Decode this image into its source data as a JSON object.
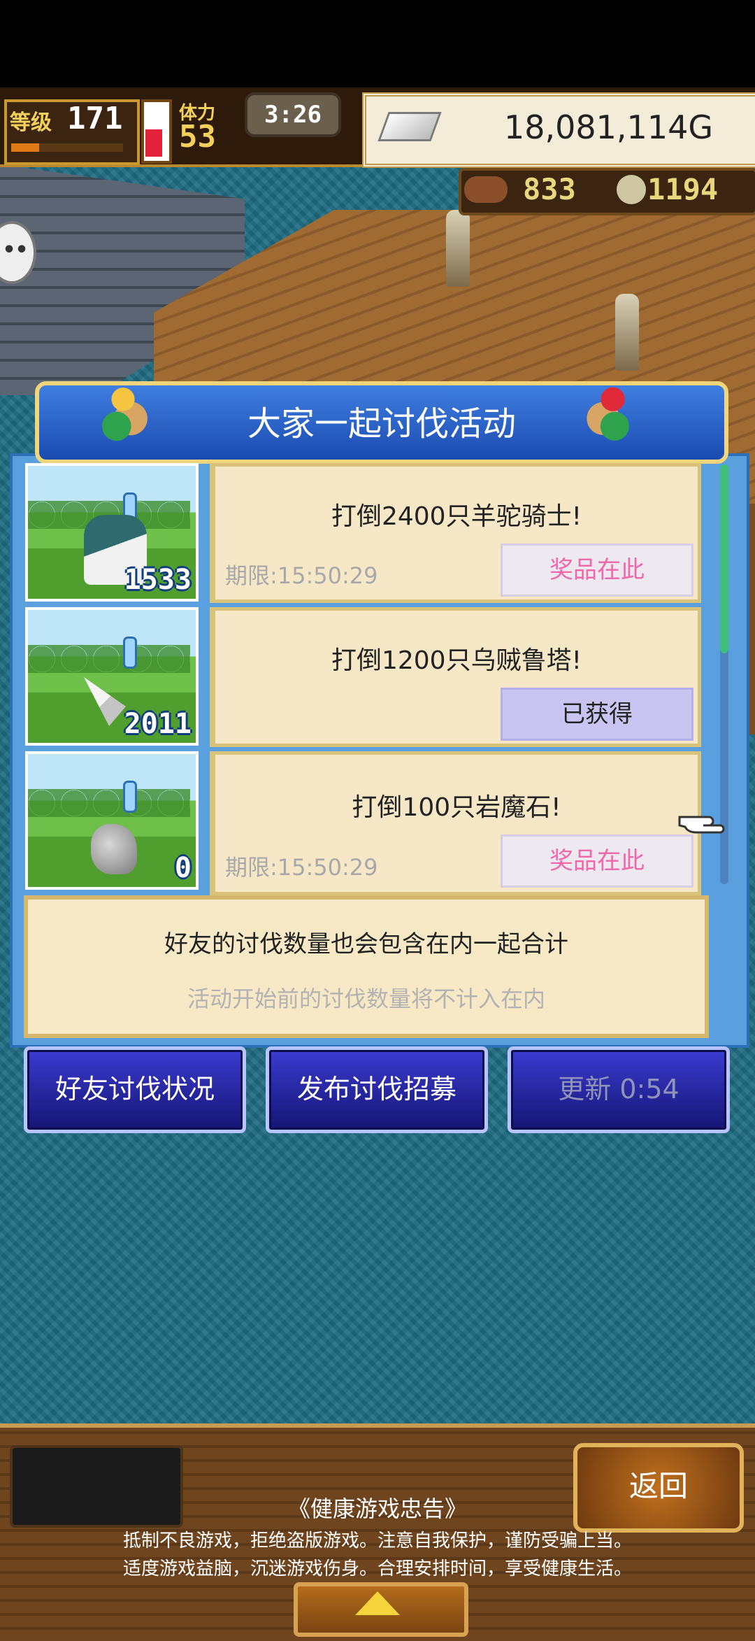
{
  "hud": {
    "level_label": "等级",
    "level": "171",
    "points_label": "体力",
    "points": "53",
    "clock": "3:26",
    "money": "18,081,114G",
    "food": "833",
    "medals": "1194"
  },
  "event": {
    "title": "大家一起讨伐活动",
    "missions": [
      {
        "text": "打倒2400只羊驼骑士!",
        "count": "1533",
        "deadline": "期限:15:50:29",
        "reward": "奖品在此",
        "claimed": false
      },
      {
        "text": "打倒1200只乌贼鲁塔!",
        "count": "2011",
        "deadline": "",
        "reward": "已获得",
        "claimed": true
      },
      {
        "text": "打倒100只岩魔石!",
        "count": "0",
        "deadline": "期限:15:50:29",
        "reward": "奖品在此",
        "claimed": false
      }
    ],
    "info_line1": "好友的讨伐数量也会包含在内一起合计",
    "info_line2": "活动开始前的讨伐数量将不计入在内"
  },
  "buttons": {
    "friend_status": "好友讨伐状况",
    "post_recruit": "发布讨伐招募",
    "refresh": "更新 0:54"
  },
  "footer": {
    "back": "返回",
    "notice_title": "《健康游戏忠告》",
    "notice_line1": "抵制不良游戏，拒绝盗版游戏。注意自我保护，谨防受骗上当。",
    "notice_line2": "适度游戏益脑，沉迷游戏伤身。合理安排时间，享受健康生活。"
  },
  "colors": {
    "sea": "#1f6c82",
    "panel_blue": "#5aa0de",
    "card_bg": "#f6e8c7",
    "reward_pink": "#ef68a8",
    "button_blue": "#151575"
  }
}
